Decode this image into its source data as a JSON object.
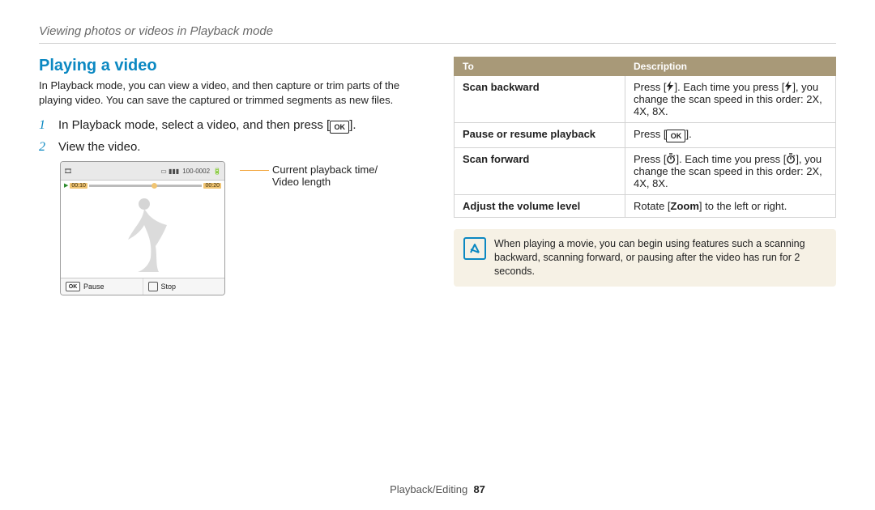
{
  "running_head": "Viewing photos or videos in Playback mode",
  "section_title": "Playing a video",
  "intro": "In Playback mode, you can view a video, and then capture or trim parts of the playing video. You can save the captured or trimmed segments as new files.",
  "steps": [
    {
      "num": "1",
      "text_pre": "In Playback mode, select a video, and then press [",
      "ok": true,
      "text_post": "]."
    },
    {
      "num": "2",
      "text_pre": "View the video.",
      "ok": false,
      "text_post": ""
    }
  ],
  "screen": {
    "time_current": "00:10",
    "time_total": "00:20",
    "topbar_right": "100-0002",
    "btn_left_icon": "OK",
    "btn_left_label": "Pause",
    "btn_right_label": "Stop"
  },
  "callout": "Current playback time/\nVideo length",
  "table": {
    "headers": [
      "To",
      "Description"
    ],
    "rows": [
      {
        "to": "Scan backward",
        "desc_parts": [
          "Press [",
          {
            "icon": "flash"
          },
          "]. Each time you press [",
          {
            "icon": "flash"
          },
          "], you change the scan speed in this order: 2X, 4X, 8X."
        ]
      },
      {
        "to": "Pause or resume playback",
        "desc_parts": [
          "Press [",
          {
            "icon": "ok"
          },
          "]."
        ]
      },
      {
        "to": "Scan forward",
        "desc_parts": [
          "Press [",
          {
            "icon": "timer"
          },
          "]. Each time you press [",
          {
            "icon": "timer"
          },
          "], you change the scan speed in this order: 2X, 4X, 8X."
        ]
      },
      {
        "to": "Adjust the volume level",
        "desc_parts": [
          "Rotate [",
          {
            "bold": "Zoom"
          },
          "] to the left or right."
        ]
      }
    ]
  },
  "note": "When playing a movie, you can begin using features such a scanning backward, scanning forward, or pausing after the video has run for 2 seconds.",
  "footer_section": "Playback/Editing",
  "footer_page": "87"
}
